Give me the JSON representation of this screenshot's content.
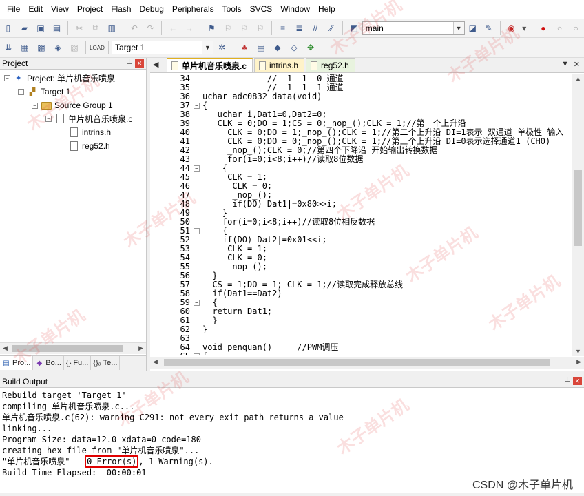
{
  "menu": [
    "File",
    "Edit",
    "View",
    "Project",
    "Flash",
    "Debug",
    "Peripherals",
    "Tools",
    "SVCS",
    "Window",
    "Help"
  ],
  "toolbar": {
    "branch": "main",
    "target": "Target 1"
  },
  "project_panel": {
    "title": "Project",
    "tree": {
      "project": "Project: 单片机音乐喷泉",
      "target": "Target 1",
      "group": "Source Group 1",
      "file": "单片机音乐喷泉.c",
      "includes": [
        "intrins.h",
        "reg52.h"
      ]
    },
    "tabs": [
      "Pro...",
      "Bo...",
      "{} Fu...",
      "{}ₐ Te..."
    ]
  },
  "editor": {
    "tabs": [
      "单片机音乐喷泉.c",
      "intrins.h",
      "reg52.h"
    ],
    "lines": [
      {
        "n": "34",
        "fold": "",
        "text": "             //  1  1  0 通道"
      },
      {
        "n": "35",
        "fold": "",
        "text": "             //  1  1  1 通道"
      },
      {
        "n": "36",
        "fold": "",
        "text": "uchar adc0832_data(void)"
      },
      {
        "n": "37",
        "fold": "-",
        "text": "{"
      },
      {
        "n": "38",
        "fold": "",
        "text": "   uchar i,Dat1=0,Dat2=0;"
      },
      {
        "n": "39",
        "fold": "",
        "text": "   CLK = 0;DO = 1;CS = 0;_nop_();CLK = 1;//第一个上升沿"
      },
      {
        "n": "40",
        "fold": "",
        "text": "     CLK = 0;DO = 1;_nop_();CLK = 1;//第二个上升沿 DI=1表示 双通道 单极性 输入"
      },
      {
        "n": "41",
        "fold": "",
        "text": "     CLK = 0;DO = 0;_nop_();CLK = 1;//第三个上升沿 DI=0表示选择通道1 (CH0)"
      },
      {
        "n": "42",
        "fold": "",
        "text": "     _nop_();CLK = 0;//第四个下降沿 开始输出转换数据"
      },
      {
        "n": "43",
        "fold": "",
        "text": "     for(i=0;i<8;i++)//读取8位数据"
      },
      {
        "n": "44",
        "fold": "-",
        "text": "    {"
      },
      {
        "n": "45",
        "fold": "",
        "text": "     CLK = 1;"
      },
      {
        "n": "46",
        "fold": "",
        "text": "      CLK = 0;"
      },
      {
        "n": "47",
        "fold": "",
        "text": "      _nop_();"
      },
      {
        "n": "48",
        "fold": "",
        "text": "      if(DO) Dat1|=0x80>>i;"
      },
      {
        "n": "49",
        "fold": "",
        "text": "    }"
      },
      {
        "n": "50",
        "fold": "",
        "text": "    for(i=0;i<8;i++)//读取8位相反数据"
      },
      {
        "n": "51",
        "fold": "-",
        "text": "    {"
      },
      {
        "n": "52",
        "fold": "",
        "text": "    if(DO) Dat2|=0x01<<i;"
      },
      {
        "n": "53",
        "fold": "",
        "text": "     CLK = 1;"
      },
      {
        "n": "54",
        "fold": "",
        "text": "     CLK = 0;"
      },
      {
        "n": "55",
        "fold": "",
        "text": "     _nop_();"
      },
      {
        "n": "56",
        "fold": "",
        "text": "  }"
      },
      {
        "n": "57",
        "fold": "",
        "text": "  CS = 1;DO = 1; CLK = 1;//读取完成释放总线"
      },
      {
        "n": "58",
        "fold": "",
        "text": "  if(Dat1==Dat2)"
      },
      {
        "n": "59",
        "fold": "-",
        "text": "  {"
      },
      {
        "n": "60",
        "fold": "",
        "text": "  return Dat1;"
      },
      {
        "n": "61",
        "fold": "",
        "text": "  }"
      },
      {
        "n": "62",
        "fold": "",
        "text": "}"
      },
      {
        "n": "63",
        "fold": "",
        "text": ""
      },
      {
        "n": "64",
        "fold": "",
        "text": "void penquan()     //PWM调压"
      },
      {
        "n": "65",
        "fold": "-",
        "text": "{"
      }
    ]
  },
  "build_output": {
    "title": "Build Output",
    "lines": [
      "Rebuild target 'Target 1'",
      "compiling 单片机音乐喷泉.c...",
      "单片机音乐喷泉.c(62): warning C291: not every exit path returns a value",
      "linking...",
      "Program Size: data=12.0 xdata=0 code=180",
      "creating hex file from \"单片机音乐喷泉\"...",
      "Build Time Elapsed:  00:00:01"
    ],
    "result_prefix": "\"单片机音乐喷泉\" - ",
    "result_errors": "0 Error(s)",
    "result_suffix": ", 1 Warning(s)."
  },
  "footer": {
    "credit": "CSDN @木子单片机"
  },
  "watermark": "木子单片机"
}
